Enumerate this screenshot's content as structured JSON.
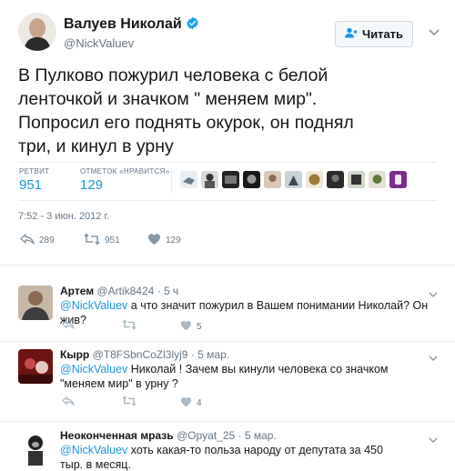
{
  "tweet": {
    "author_name": "Валуев Николай",
    "author_handle": "@NickValuev",
    "follow_label": "Читать",
    "text": "В Пулково пожурил человека с белой\nленточкой и значком \" меняем мир\".\nПопросил его поднять окурок, он  поднял\nтри, и кинул в урну",
    "retweets_label": "РЕТВИТ",
    "retweets_count": "951",
    "likes_label": "ОТМЕТОК «НРАВИТСЯ»",
    "likes_count": "129",
    "timestamp": "7:52 - 3 июн. 2012 г.",
    "reply_count": "289",
    "retweet_count_action": "951",
    "like_count_action": "129"
  },
  "replies": [
    {
      "name": "Артем",
      "handle": "@Artik8424",
      "date": "5 ч",
      "mention": "@NickValuev",
      "text": " а что значит пожурил в Вашем понимании Николай? Он жив?",
      "likes": "5"
    },
    {
      "name": "Кырр",
      "handle": "@T8FSbnCoZl3lyj9",
      "date": "5 мар.",
      "mention": "@NickValuev",
      "text": " Николай ! Зачем вы кинули человека со значком \"меняем мир\" в урну ?",
      "likes": "4"
    },
    {
      "name": "Неоконченная мразь",
      "handle": "@Opyat_25",
      "date": "5 мар.",
      "mention": "@NickValuev",
      "text": " хоть какая-то польза народу от депутата за 450 тыр. в месяц."
    }
  ],
  "colors": {
    "link": "#1b95e0",
    "secondary": "#657786",
    "text": "#14171a",
    "verified": "#1da1f2"
  },
  "icons": [
    "verified-badge-icon",
    "follow-user-icon",
    "chevron-down-icon",
    "reply-icon",
    "retweet-icon",
    "like-icon"
  ]
}
